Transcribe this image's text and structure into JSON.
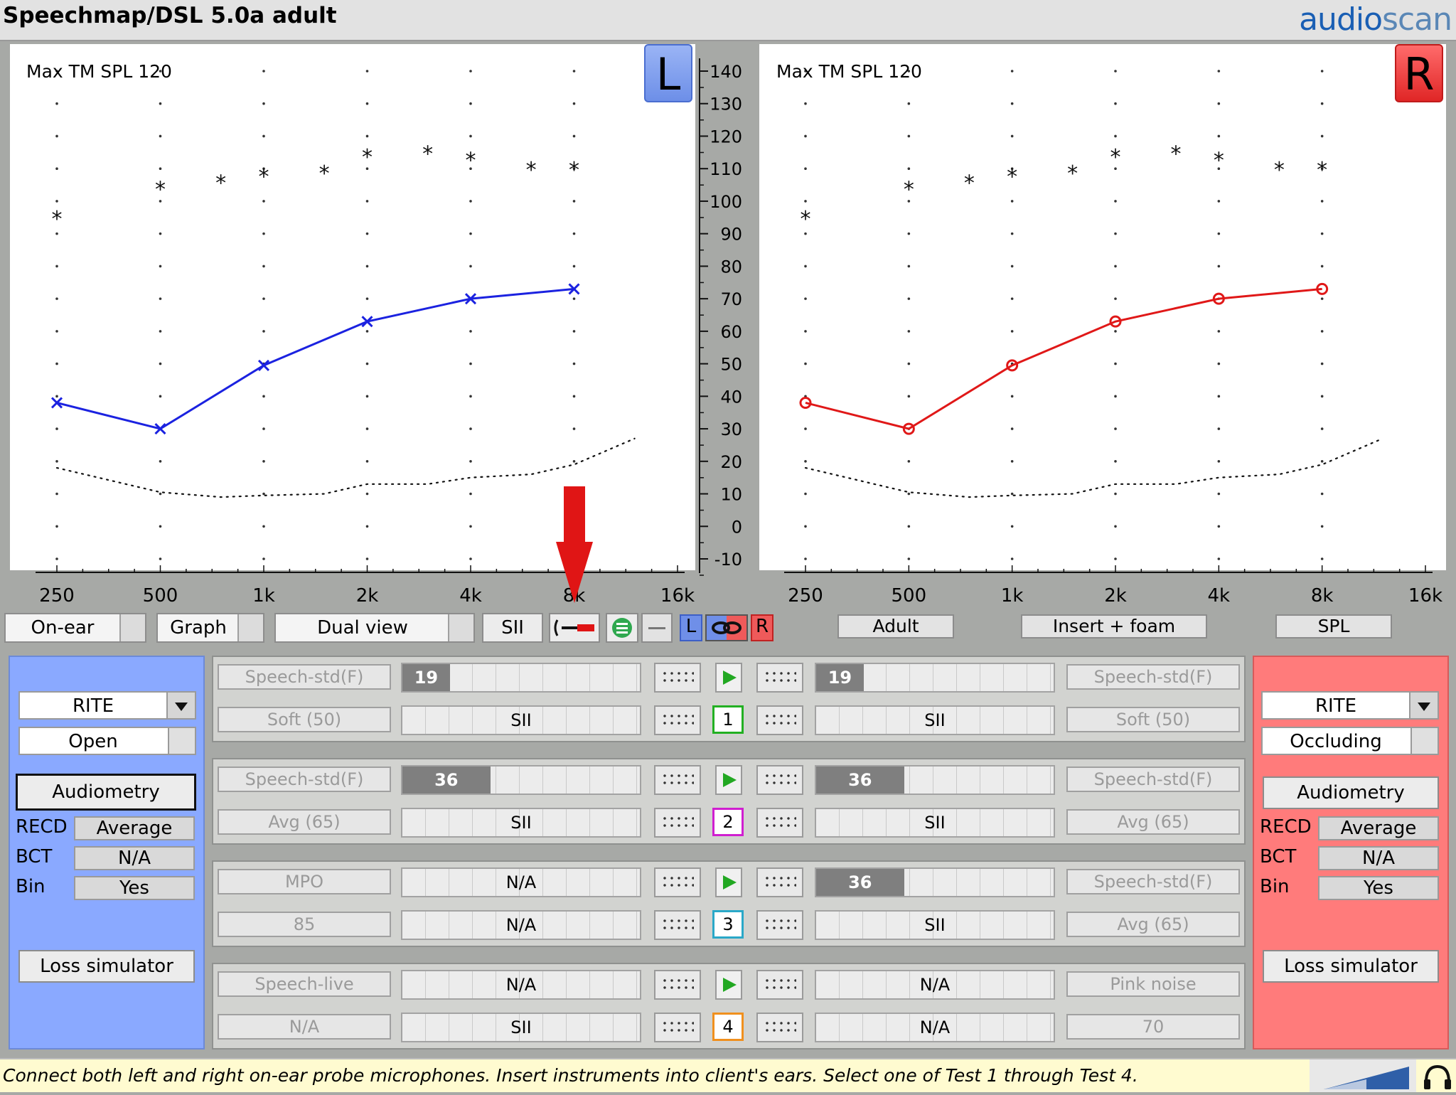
{
  "app": {
    "title": "Speechmap/DSL 5.0a adult",
    "brand_audio": "audio",
    "brand_scan": "scan"
  },
  "graph": {
    "left": {
      "max_tm": "Max TM SPL 120",
      "ear": "L"
    },
    "right": {
      "max_tm": "Max TM SPL 120",
      "ear": "R"
    },
    "y_labels": [
      "140",
      "130",
      "120",
      "110",
      "100",
      "90",
      "80",
      "70",
      "60",
      "50",
      "40",
      "30",
      "20",
      "10",
      "0",
      "-10"
    ],
    "x_labels": [
      "250",
      "500",
      "1k",
      "2k",
      "4k",
      "8k",
      "16k"
    ]
  },
  "chart_data": {
    "type": "line",
    "x": [
      250,
      500,
      1000,
      2000,
      4000,
      8000
    ],
    "x_tick_labels": [
      "250",
      "500",
      "1k",
      "2k",
      "4k",
      "8k",
      "16k"
    ],
    "ylim": [
      -10,
      140
    ],
    "y_ticks": [
      -10,
      0,
      10,
      20,
      30,
      40,
      50,
      60,
      70,
      80,
      90,
      100,
      110,
      120,
      130,
      140
    ],
    "series": [
      {
        "ear": "left",
        "color": "#1b22e0",
        "marker": "x",
        "x": [
          250,
          500,
          1000,
          2000,
          4000,
          8000
        ],
        "values": [
          38,
          30,
          49.5,
          63,
          70,
          73
        ]
      },
      {
        "ear": "right",
        "color": "#e01818",
        "marker": "o",
        "x": [
          250,
          500,
          1000,
          2000,
          4000,
          8000
        ],
        "values": [
          38,
          30,
          49.5,
          63,
          70,
          73
        ]
      }
    ],
    "ucl_points": {
      "marker": "*",
      "x": [
        250,
        500,
        750,
        1000,
        1500,
        2000,
        3000,
        4000,
        6000,
        8000
      ],
      "values": [
        95,
        104,
        106,
        108,
        109,
        114,
        115,
        113,
        110,
        110
      ]
    },
    "threshold_curve": {
      "style": "dotted",
      "x": [
        250,
        500,
        750,
        1000,
        1500,
        2000,
        3000,
        4000,
        6000,
        8000,
        12000
      ],
      "values": [
        18,
        10.5,
        9,
        9.5,
        10,
        13,
        13,
        15,
        16,
        19,
        27
      ]
    },
    "grid": true
  },
  "toolbar": {
    "mode": "On-ear",
    "display": "Graph",
    "view": "Dual view",
    "sii": "SII",
    "ear_l": "L",
    "ear_r": "R",
    "age": "Adult",
    "transducer": "Insert + foam",
    "scale": "SPL"
  },
  "left_ear": {
    "instrument": "RITE",
    "vent": "Open",
    "audiometry": "Audiometry",
    "recd_label": "RECD",
    "recd": "Average",
    "bct_label": "BCT",
    "bct": "N/A",
    "bin_label": "Bin",
    "bin": "Yes",
    "loss_sim": "Loss simulator"
  },
  "right_ear": {
    "instrument": "RITE",
    "vent": "Occluding",
    "audiometry": "Audiometry",
    "recd_label": "RECD",
    "recd": "Average",
    "bct_label": "BCT",
    "bct": "N/A",
    "bin_label": "Bin",
    "bin": "Yes",
    "loss_sim": "Loss simulator"
  },
  "tests": [
    {
      "num": "1",
      "color": "#22b022",
      "left": {
        "stim": "Speech-std(F)",
        "level": "Soft (50)",
        "meter_top": "19",
        "meter_top_pct": 0.2,
        "meter_bottom": "SII"
      },
      "right": {
        "stim": "Speech-std(F)",
        "level": "Soft (50)",
        "meter_top": "19",
        "meter_top_pct": 0.2,
        "meter_bottom": "SII"
      }
    },
    {
      "num": "2",
      "color": "#d01fd0",
      "left": {
        "stim": "Speech-std(F)",
        "level": "Avg (65)",
        "meter_top": "36",
        "meter_top_pct": 0.37,
        "meter_bottom": "SII"
      },
      "right": {
        "stim": "Speech-std(F)",
        "level": "Avg (65)",
        "meter_top": "36",
        "meter_top_pct": 0.37,
        "meter_bottom": "SII"
      }
    },
    {
      "num": "3",
      "color": "#2aa8c8",
      "left": {
        "stim": "MPO",
        "level": "85",
        "meter_top": "N/A",
        "meter_top_pct": 0,
        "meter_bottom": "N/A"
      },
      "right": {
        "stim": "Speech-std(F)",
        "level": "Avg (65)",
        "meter_top": "36",
        "meter_top_pct": 0.37,
        "meter_bottom": "SII"
      }
    },
    {
      "num": "4",
      "color": "#f0901e",
      "left": {
        "stim": "Speech-live",
        "level": "N/A",
        "meter_top": "N/A",
        "meter_top_pct": 0,
        "meter_bottom": "SII"
      },
      "right": {
        "stim": "Pink noise",
        "level": "70",
        "meter_top": "N/A",
        "meter_top_pct": 0,
        "meter_bottom": "N/A"
      }
    }
  ],
  "status": {
    "message": "Connect both left and right on-ear probe microphones.  Insert instruments into client's ears.  Select one of Test 1 through Test 4."
  }
}
